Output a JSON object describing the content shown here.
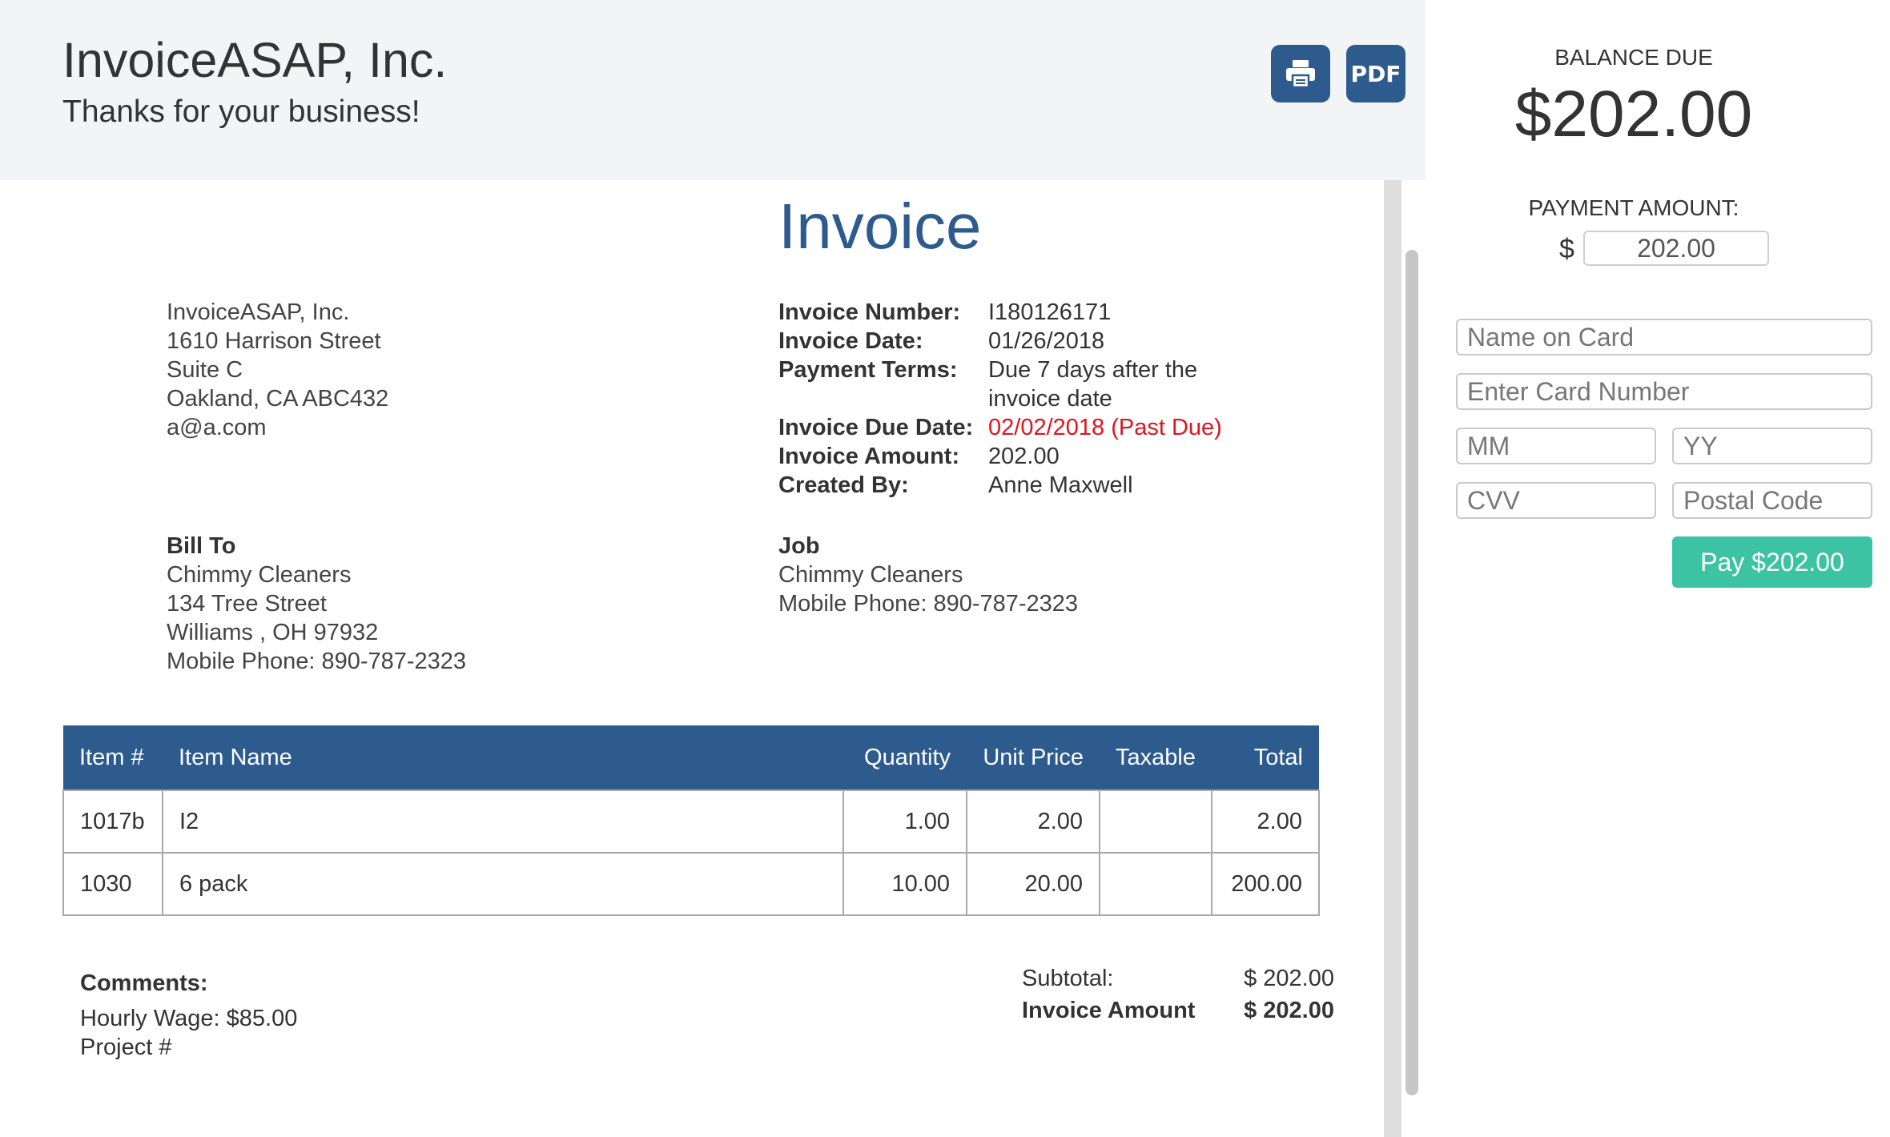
{
  "header": {
    "company_name": "InvoiceASAP, Inc.",
    "tagline": "Thanks for your business!",
    "pdf_label": "PDF"
  },
  "invoice": {
    "title": "Invoice",
    "from": {
      "name": "InvoiceASAP, Inc.",
      "street": "1610 Harrison Street",
      "suite": "Suite C",
      "city": "Oakland, CA ABC432",
      "email": "a@a.com"
    },
    "meta": {
      "number_label": "Invoice Number:",
      "number": "I180126171",
      "date_label": "Invoice Date:",
      "date": "01/26/2018",
      "terms_label": "Payment Terms:",
      "terms_line1": "Due 7 days after the",
      "terms_line2": "invoice date",
      "due_label": "Invoice Due Date:",
      "due": "02/02/2018 (Past Due)",
      "amount_label": "Invoice Amount:",
      "amount": "202.00",
      "created_label": "Created By:",
      "created": "Anne Maxwell"
    },
    "bill_to": {
      "heading": "Bill To",
      "name": "Chimmy Cleaners",
      "street": "134 Tree Street",
      "city": "Williams , OH 97932",
      "phone": "Mobile Phone: 890-787-2323"
    },
    "job": {
      "heading": "Job",
      "name": "Chimmy Cleaners",
      "phone": "Mobile Phone: 890-787-2323"
    },
    "table": {
      "headers": [
        "Item #",
        "Item Name",
        "Quantity",
        "Unit Price",
        "Taxable",
        "Total"
      ],
      "rows": [
        [
          "1017b",
          "I2",
          "1.00",
          "2.00",
          "",
          "2.00"
        ],
        [
          "1030",
          "6 pack",
          "10.00",
          "20.00",
          "",
          "200.00"
        ]
      ]
    },
    "comments": {
      "heading": "Comments:",
      "line1": "Hourly Wage: $85.00",
      "line2": "Project #"
    },
    "totals": {
      "subtotal_label": "Subtotal:",
      "subtotal": "$ 202.00",
      "amount_label": "Invoice Amount",
      "amount": "$ 202.00"
    }
  },
  "payment": {
    "balance_label": "BALANCE DUE",
    "balance": "$202.00",
    "amount_label": "PAYMENT AMOUNT:",
    "currency": "$",
    "amount_value": "202.00",
    "name_placeholder": "Name on Card",
    "card_placeholder": "Enter Card Number",
    "mm_placeholder": "MM",
    "yy_placeholder": "YY",
    "cvv_placeholder": "CVV",
    "postal_placeholder": "Postal Code",
    "pay_label": "Pay $202.00"
  },
  "colors": {
    "brand_blue": "#2e5b8e",
    "pay_green": "#3cc3a3",
    "past_due_red": "#e0141e"
  },
  "icons": [
    "printer-icon"
  ]
}
